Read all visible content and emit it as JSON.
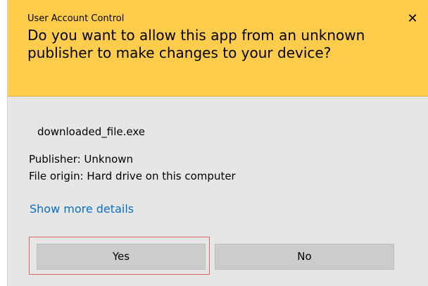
{
  "dialog": {
    "title": "User Account Control",
    "close_icon": "close-icon",
    "question": "Do you want to allow this app from an unknown publisher to make changes to your device?",
    "filename": "downloaded_file.exe",
    "publisher": "Publisher: Unknown",
    "file_origin": "File origin: Hard drive on this computer",
    "details_link": "Show more details",
    "yes_label": "Yes",
    "no_label": "No"
  },
  "colors": {
    "header_background": "#ffcd4b",
    "body_background": "#e6e6e6",
    "link": "#0a6fc2",
    "button_background": "#cccccc",
    "focus_outline": "#e06666"
  }
}
